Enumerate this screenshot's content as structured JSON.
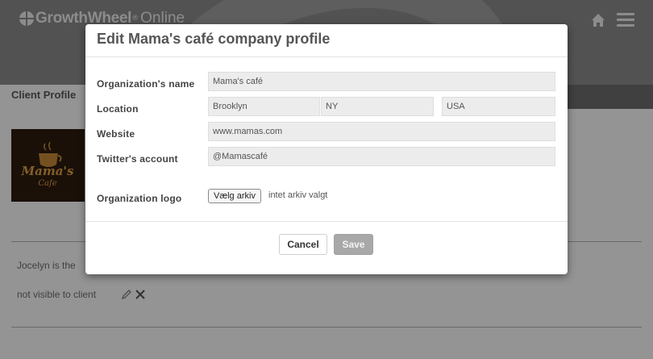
{
  "header": {
    "brand": "GrowthWheel",
    "brand_mark": "®",
    "brand_suffix": "Online",
    "icons": [
      "home-icon",
      "menu-icon"
    ]
  },
  "page": {
    "title": "Client Profile",
    "note_text": "Jocelyn is the",
    "visibility_text": "not visible to client",
    "row_icons": [
      "pencil-icon",
      "close-icon"
    ]
  },
  "modal": {
    "title": "Edit Mama's café company profile",
    "fields": {
      "org_name": {
        "label": "Organization's name",
        "value": "Mama's café"
      },
      "location": {
        "label": "Location",
        "city": "Brooklyn",
        "state": "NY",
        "country": "USA"
      },
      "website": {
        "label": "Website",
        "value": "www.mamas.com"
      },
      "twitter": {
        "label": "Twitter's account",
        "value": "@Mamascafé"
      },
      "logo": {
        "label": "Organization logo",
        "button": "Vælg arkiv",
        "status": "intet arkiv valgt"
      }
    },
    "buttons": {
      "cancel": "Cancel",
      "save": "Save"
    }
  },
  "colors": {
    "header_bg": "#8e8e8e",
    "overlay": "rgba(0,0,0,0.42)",
    "save_disabled": "#a8a8a8",
    "field_bg": "#ececec"
  }
}
